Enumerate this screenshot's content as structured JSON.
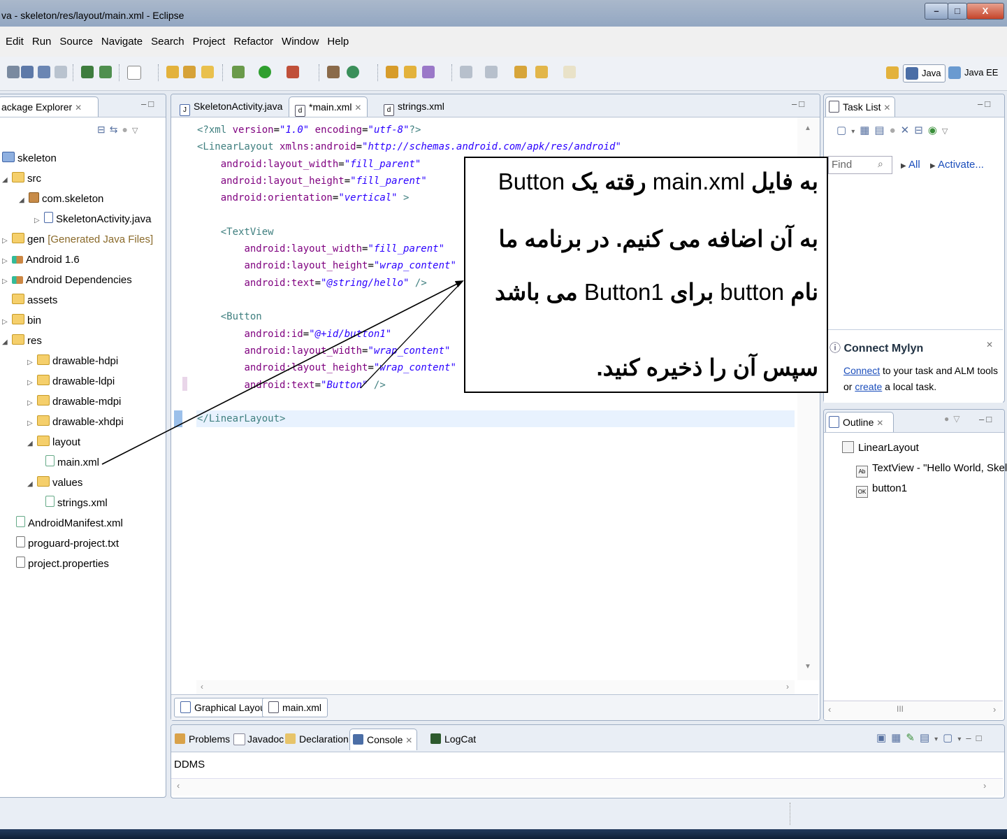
{
  "window": {
    "title": "va - skeleton/res/layout/main.xml - Eclipse",
    "buttons": {
      "minimize": "–",
      "maximize": "□",
      "close": "X"
    }
  },
  "menu": [
    "Edit",
    "Run",
    "Source",
    "Navigate",
    "Search",
    "Project",
    "Refactor",
    "Window",
    "Help"
  ],
  "perspectives": [
    {
      "label": "Java",
      "active": true
    },
    {
      "label": "Java EE",
      "active": false
    }
  ],
  "package_explorer": {
    "tab": "ackage Explorer",
    "tree": [
      {
        "label": "skeleton",
        "decor": ""
      },
      {
        "label": "src",
        "decor": ""
      },
      {
        "label": "com.skeleton",
        "decor": ""
      },
      {
        "label": "SkeletonActivity.java",
        "decor": ""
      },
      {
        "label": "gen",
        "decor": "[Generated Java Files]"
      },
      {
        "label": "Android 1.6",
        "decor": ""
      },
      {
        "label": "Android Dependencies",
        "decor": ""
      },
      {
        "label": "assets",
        "decor": ""
      },
      {
        "label": "bin",
        "decor": ""
      },
      {
        "label": "res",
        "decor": ""
      },
      {
        "label": "drawable-hdpi",
        "decor": ""
      },
      {
        "label": "drawable-ldpi",
        "decor": ""
      },
      {
        "label": "drawable-mdpi",
        "decor": ""
      },
      {
        "label": "drawable-xhdpi",
        "decor": ""
      },
      {
        "label": "layout",
        "decor": ""
      },
      {
        "label": "main.xml",
        "decor": ""
      },
      {
        "label": "values",
        "decor": ""
      },
      {
        "label": "strings.xml",
        "decor": ""
      },
      {
        "label": "AndroidManifest.xml",
        "decor": ""
      },
      {
        "label": "proguard-project.txt",
        "decor": ""
      },
      {
        "label": "project.properties",
        "decor": ""
      }
    ]
  },
  "editor": {
    "tabs": [
      {
        "label": "SkeletonActivity.java",
        "active": false
      },
      {
        "label": "*main.xml",
        "active": true
      },
      {
        "label": "strings.xml",
        "active": false
      }
    ],
    "code": [
      "<?xml version=\"1.0\" encoding=\"utf-8\"?>",
      "<LinearLayout xmlns:android=\"http://schemas.android.com/apk/res/android\"",
      "    android:layout_width=\"fill_parent\"",
      "    android:layout_height=\"fill_parent\"",
      "    android:orientation=\"vertical\" >",
      "",
      "    <TextView",
      "        android:layout_width=\"fill_parent\"",
      "        android:layout_height=\"wrap_content\"",
      "        android:text=\"@string/hello\" />",
      "",
      "    <Button",
      "        android:id=\"@+id/button1\"",
      "        android:layout_width=\"wrap_content\"",
      "        android:layout_height=\"wrap_content\"",
      "        android:text=\"Button\" />",
      "",
      "</LinearLayout>"
    ],
    "bottom_tabs": [
      "Graphical Layout",
      "main.xml"
    ]
  },
  "callout": {
    "lines": [
      [
        {
          "t": "به فایل",
          "b": true
        },
        {
          "t": " main.xml ",
          "b": false
        },
        {
          "t": "رقته  یک",
          "b": true
        },
        {
          "t": " Button",
          "b": false
        }
      ],
      [
        {
          "t": "به آن اضافه می کنیم. در برنامه ما",
          "b": true
        }
      ],
      [
        {
          "t": "نام",
          "b": true
        },
        {
          "t": " button ",
          "b": false
        },
        {
          "t": "برای",
          "b": true
        },
        {
          "t": " Button1 ",
          "b": false
        },
        {
          "t": "می باشد",
          "b": true
        }
      ],
      [
        {
          "t": "سپس آن را ذخیره کنید.",
          "b": true
        }
      ]
    ]
  },
  "task_list": {
    "tab": "Task List",
    "find_placeholder": "Find",
    "filter_all": "All",
    "activate": "Activate..."
  },
  "mylyn": {
    "title": "Connect Mylyn",
    "connect": "Connect",
    "text1": " to your task and ALM tools",
    "or": "or ",
    "create": "create",
    "text2": " a local task."
  },
  "outline": {
    "tab": "Outline",
    "items": [
      {
        "label": "LinearLayout"
      },
      {
        "label": "TextView - \"Hello World, Skeleto"
      },
      {
        "label": "button1"
      }
    ],
    "scroll_label": "III"
  },
  "bottom_panel": {
    "tabs": [
      "Problems",
      "Javadoc",
      "Declaration",
      "Console",
      "LogCat"
    ],
    "console_text": "DDMS"
  }
}
